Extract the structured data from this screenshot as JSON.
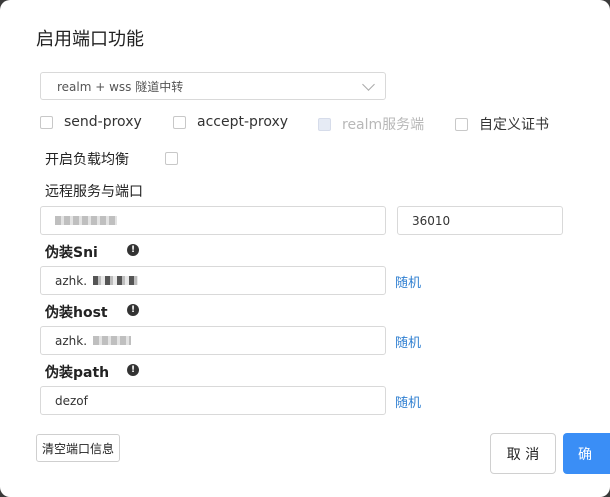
{
  "dialog": {
    "title": "启用端口功能",
    "mode_select": {
      "value": "realm + wss 隧道中转"
    },
    "checkboxes": [
      {
        "label": "send-proxy",
        "checked": false,
        "disabled": false
      },
      {
        "label": "accept-proxy",
        "checked": false,
        "disabled": false
      },
      {
        "label": "realm服务端",
        "checked": false,
        "disabled": true
      },
      {
        "label": "自定义证书",
        "checked": false,
        "disabled": false
      }
    ],
    "load_balance": {
      "label": "开启负载均衡",
      "checked": false
    },
    "remote": {
      "label": "远程服务与端口",
      "port_value": "36010"
    },
    "sni": {
      "label": "伪装Sni",
      "value_prefix": "azhk.",
      "random_label": "随机"
    },
    "host": {
      "label": "伪装host",
      "value_prefix": "azhk.",
      "random_label": "随机"
    },
    "path": {
      "label": "伪装path",
      "value": "dezof",
      "random_label": "随机"
    },
    "info_glyph": "!",
    "clear_button": "清空端口信息",
    "cancel_button": "取 消",
    "ok_button": "确"
  },
  "colors": {
    "primary": "#3a8ef6",
    "link": "#2f7fd1"
  }
}
